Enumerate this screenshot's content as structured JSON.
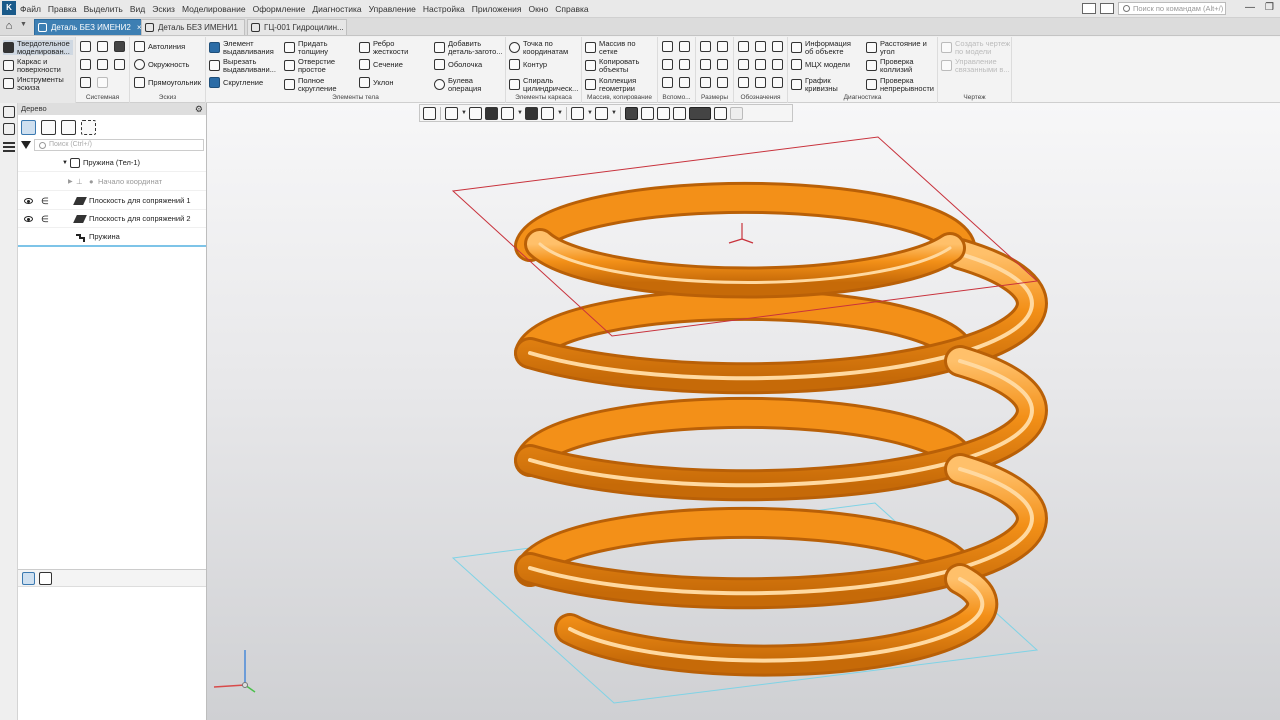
{
  "app": {
    "logo_text": "K"
  },
  "menu": [
    "Файл",
    "Правка",
    "Выделить",
    "Вид",
    "Эскиз",
    "Моделирование",
    "Оформление",
    "Диагностика",
    "Управление",
    "Настройка",
    "Приложения",
    "Окно",
    "Справка"
  ],
  "search": {
    "placeholder": "Поиск по командам (Alt+/)"
  },
  "tabs": [
    {
      "label": "Деталь БЕЗ ИМЕНИ2",
      "active": true,
      "close": "×"
    },
    {
      "label": "Деталь БЕЗ ИМЕНИ1",
      "active": false,
      "close": ""
    },
    {
      "label": "ГЦ-001 Гидроцилин...",
      "active": false,
      "close": ""
    }
  ],
  "ribbon": {
    "modes": [
      {
        "label": "Твердотельное\nмоделирован...",
        "icon": "solid-modeling-icon"
      },
      {
        "label": "Каркас и\nповерхности",
        "icon": "wireframe-icon"
      },
      {
        "label": "Инструменты\nэскиза",
        "icon": "sketch-tools-icon"
      }
    ],
    "groups": {
      "system": "Системная",
      "sketch": "Эскиз",
      "body": "Элементы тела",
      "frame": "Элементы каркаса",
      "array": "Массив, копирование",
      "aux": "Вспомо...",
      "dims": "Размеры",
      "notations": "Обозначения",
      "diag": "Диагностика",
      "drawing": "Чертеж"
    },
    "sketch_buttons": [
      "Автолиния",
      "Окружность",
      "Прямоугольник"
    ],
    "body_buttons": [
      "Элемент\nвыдавливания",
      "Вырезать\nвыдавливани...",
      "Скругление",
      "Придать\nтолщину",
      "Отверстие\nпростое",
      "Полное\nскругление",
      "Ребро\nжесткости",
      "Сечение",
      "Уклон",
      "Добавить\nдеталь-загото...",
      "Оболочка",
      "Булева\nоперация"
    ],
    "frame_buttons": [
      "Точка по\nкоординатам",
      "Контур",
      "Спираль\nцилиндрическ..."
    ],
    "array_buttons": [
      "Массив по\nсетке",
      "Копировать\nобъекты",
      "Коллекция\nгеометрии"
    ],
    "diag_buttons": [
      "Информация\nоб объекте",
      "МЦХ модели",
      "График\nкривизны",
      "Расстояние и\nугол",
      "Проверка\nколлизий",
      "Проверка\nнепрерывности"
    ],
    "drawing_buttons": [
      "Создать чертеж\nпо модели",
      "Управление\nсвязанными в..."
    ]
  },
  "tree": {
    "title": "Дерево",
    "search_placeholder": "Поиск (Ctrl+/)",
    "rows": [
      {
        "label": "Пружина (Тел-1)",
        "indent": 1
      },
      {
        "label": "Начало координат",
        "muted": true
      },
      {
        "label": "Плоскость для сопряжений 1",
        "eye": true
      },
      {
        "label": "Плоскость для сопряжений 2",
        "eye": true
      },
      {
        "label": "Пружина"
      }
    ]
  },
  "colors": {
    "spring": "#f39018",
    "active_tab": "#3d7fb3",
    "plane_top": "#c8323c",
    "plane_bottom": "#7fd3e6"
  }
}
